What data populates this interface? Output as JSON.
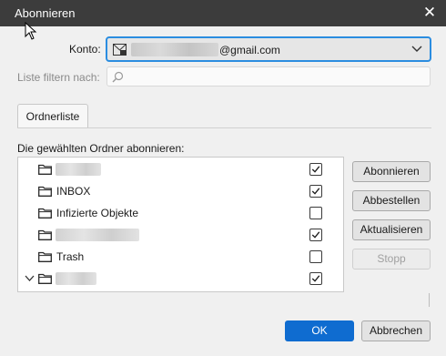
{
  "window": {
    "title": "Abonnieren",
    "close_glyph": "✕"
  },
  "account": {
    "label": "Konto:",
    "email_visible": "@gmail.com"
  },
  "filter": {
    "label": "Liste filtern nach:",
    "placeholder": "",
    "value": ""
  },
  "tab": {
    "label": "Ordnerliste"
  },
  "list": {
    "title": "Die gewählten Ordner abonnieren:"
  },
  "folders": [
    {
      "name": "",
      "redacted": true,
      "checked": true
    },
    {
      "name": "INBOX",
      "redacted": false,
      "checked": true
    },
    {
      "name": "Infizierte Objekte",
      "redacted": false,
      "checked": false
    },
    {
      "name": "",
      "redacted": true,
      "checked": true
    },
    {
      "name": "Trash",
      "redacted": false,
      "checked": false
    },
    {
      "name": "",
      "redacted": true,
      "checked": true,
      "expanded": true
    }
  ],
  "buttons": {
    "subscribe": "Abonnieren",
    "unsubscribe": "Abbestellen",
    "refresh": "Aktualisieren",
    "stop": "Stopp",
    "ok": "OK",
    "cancel": "Abbrechen"
  },
  "icons": {
    "close": "close-icon",
    "account": "envelope-icon",
    "dropdown": "chevron-down-icon",
    "search": "search-icon",
    "folder": "folder-icon",
    "checkbox": "checkbox-icon",
    "twisty": "chevron-down-icon"
  },
  "colors": {
    "titlebar": "#3c3c3c",
    "accent": "#0f6cd0",
    "focus": "#2b8de0",
    "dialog_bg": "#f0f0f0"
  }
}
